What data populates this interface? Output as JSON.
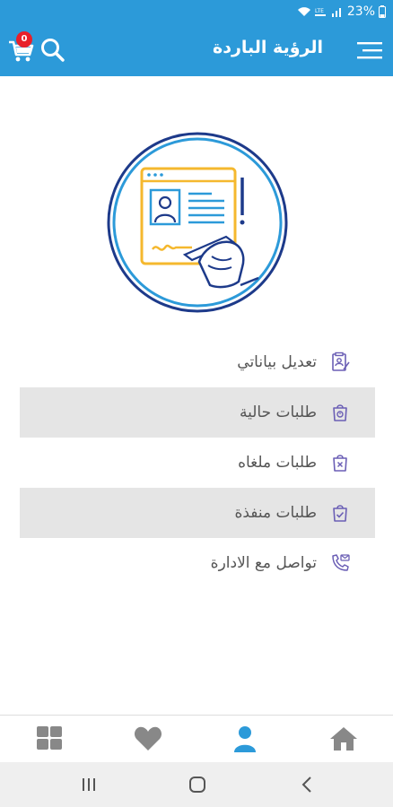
{
  "status_bar": {
    "battery": "23%"
  },
  "app_bar": {
    "title": "الرؤية الباردة",
    "cart_count": "0",
    "menu_icon": "menu-icon",
    "cart_icon": "cart-icon",
    "search_icon": "search-icon"
  },
  "profile": {
    "illustration": "profile-edit-illustration"
  },
  "menu": {
    "items": [
      {
        "label": "تعديل بياناتي",
        "icon": "edit-profile-icon",
        "shaded": false
      },
      {
        "label": "طلبات حالية",
        "icon": "current-orders-icon",
        "shaded": true
      },
      {
        "label": "طلبات ملغاه",
        "icon": "cancelled-orders-icon",
        "shaded": false
      },
      {
        "label": "طلبات منفذة",
        "icon": "completed-orders-icon",
        "shaded": true
      },
      {
        "label": "تواصل مع الادارة",
        "icon": "contact-admin-icon",
        "shaded": false
      }
    ]
  },
  "bottom_nav": {
    "items": [
      {
        "icon": "grid-icon"
      },
      {
        "icon": "heart-icon"
      },
      {
        "icon": "user-icon",
        "active": true
      },
      {
        "icon": "home-icon"
      }
    ]
  },
  "colors": {
    "primary": "#2c9ad9",
    "icon_purple": "#6b5fb5",
    "nav_gray": "#888888",
    "badge_red": "#e8202a",
    "illustration_yellow": "#f5b82e",
    "illustration_navy": "#1d3a8a"
  }
}
